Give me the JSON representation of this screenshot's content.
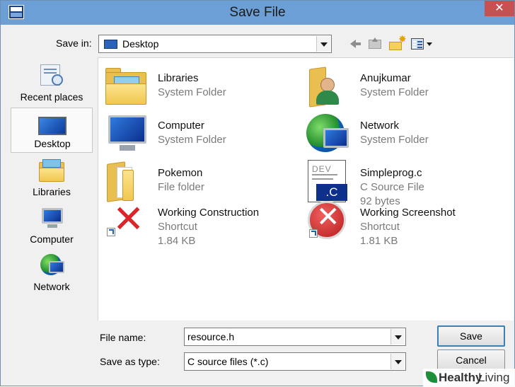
{
  "window": {
    "title": "Save File",
    "close": "✕",
    "app_icon": "dev-cpp-icon"
  },
  "toolbar": {
    "save_in_label": "Save in:",
    "save_in_value": "Desktop",
    "back_icon": "back-arrow-icon",
    "up_icon": "up-folder-icon",
    "new_folder_icon": "new-folder-icon",
    "view_menu_icon": "view-menu-icon"
  },
  "places": [
    {
      "label": "Recent places",
      "icon": "recent-places-icon"
    },
    {
      "label": "Desktop",
      "icon": "desktop-icon",
      "selected": true
    },
    {
      "label": "Libraries",
      "icon": "libraries-icon"
    },
    {
      "label": "Computer",
      "icon": "computer-icon"
    },
    {
      "label": "Network",
      "icon": "network-icon"
    }
  ],
  "files": [
    {
      "name": "Libraries",
      "line1": "System Folder",
      "line2": "",
      "icon": "libraries-folder-icon"
    },
    {
      "name": "Anujkumar",
      "line1": "System Folder",
      "line2": "",
      "icon": "user-folder-icon"
    },
    {
      "name": "Computer",
      "line1": "System Folder",
      "line2": "",
      "icon": "computer-icon"
    },
    {
      "name": "Network",
      "line1": "System Folder",
      "line2": "",
      "icon": "network-icon"
    },
    {
      "name": "Pokemon",
      "line1": "File folder",
      "line2": "",
      "icon": "folder-icon"
    },
    {
      "name": "Simpleprog.c",
      "line1": "C Source File",
      "line2": "92 bytes",
      "icon": "c-source-file-icon"
    },
    {
      "name": "Working Construction",
      "line1": "Shortcut",
      "line2": "1.84 KB",
      "icon": "red-x-shortcut-icon"
    },
    {
      "name": "Working Screenshot",
      "line1": "Shortcut",
      "line2": "1.81 KB",
      "icon": "error-shortcut-icon"
    }
  ],
  "c_file_badge": ".C",
  "c_file_logo": "DEV",
  "form": {
    "filename_label": "File name:",
    "filename_value": "resource.h",
    "type_label": "Save as type:",
    "type_value": "C source files (*.c)",
    "save_button": "Save",
    "cancel_button": "Cancel"
  },
  "watermark": {
    "part1": "Healthy",
    "part2": "Living"
  }
}
